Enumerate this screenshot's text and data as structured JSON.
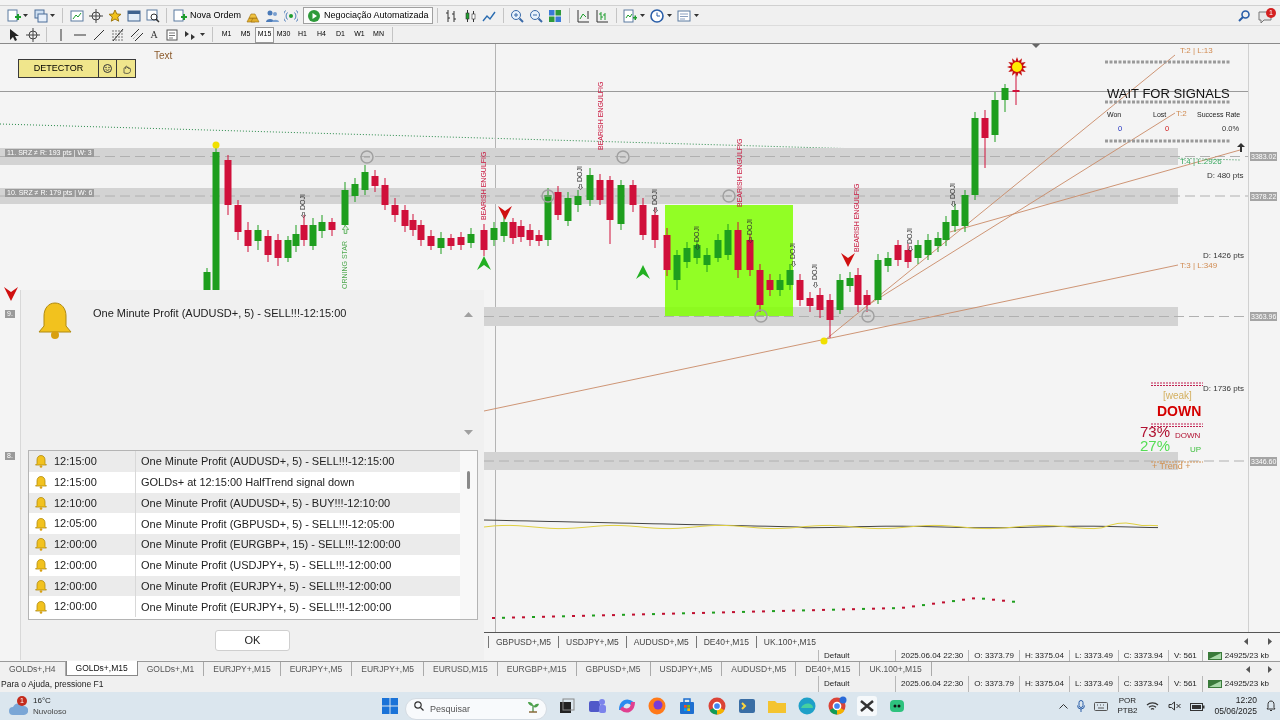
{
  "toolbar": {
    "order_button": "Nova Ordem",
    "algo_button": {
      "label": "Negociação Automatizada",
      "on": true
    },
    "alerts_badge": "1",
    "text_tool": "A",
    "timeframes": [
      {
        "label": "M1",
        "selected": false
      },
      {
        "label": "M5",
        "selected": false
      },
      {
        "label": "M15",
        "selected": true
      },
      {
        "label": "M30",
        "selected": false
      },
      {
        "label": "H1",
        "selected": false
      },
      {
        "label": "H4",
        "selected": false
      },
      {
        "label": "D1",
        "selected": false
      },
      {
        "label": "W1",
        "selected": false
      },
      {
        "label": "MN",
        "selected": false
      }
    ]
  },
  "chart": {
    "detector_panel": {
      "label": "DETECTOR"
    },
    "text_object": "Text",
    "zones": [
      {
        "label": "11. SRZ ≠ R: 193 pts | W: 3",
        "price": "3383.02"
      },
      {
        "label": "10. SRZ ≠ R: 179 pts | W: 6",
        "price": "3378.22"
      },
      {
        "label": "9.",
        "price": "3363.96"
      },
      {
        "label": "8.",
        "price": "3346.60"
      }
    ],
    "patterns": [
      {
        "kind": "doji",
        "text": "DOJI"
      },
      {
        "kind": "bullish",
        "text": "ORNING STAR"
      },
      {
        "kind": "bearish",
        "text": "BEARISH ENGULFIG"
      },
      {
        "kind": "doji",
        "text": "DOJI"
      },
      {
        "kind": "bearish",
        "text": "BEARISH ENGULFIG"
      },
      {
        "kind": "doji",
        "text": "DOJI"
      },
      {
        "kind": "doji",
        "text": "DOJI"
      },
      {
        "kind": "bearish",
        "text": "BEARISH ENGULFIG"
      },
      {
        "kind": "doji",
        "text": "DOJI"
      },
      {
        "kind": "doji",
        "text": "DOJI"
      },
      {
        "kind": "doji",
        "text": "DOJI"
      },
      {
        "kind": "bearish",
        "text": "BEARISH ENGULFIG"
      },
      {
        "kind": "doji",
        "text": "DOJI"
      },
      {
        "kind": "doji",
        "text": "DOJI"
      }
    ],
    "line_labels": [
      {
        "kind": "trendline",
        "text": "T:2 | L:13"
      },
      {
        "kind": "trendline",
        "text": "T:2"
      },
      {
        "kind": "dotline",
        "text": "T:4 | L:2926"
      },
      {
        "kind": "distance",
        "text": "D: 480 pts"
      },
      {
        "kind": "distance",
        "text": "D: 1426 pts"
      },
      {
        "kind": "trendline",
        "text": "T:3 | L:349"
      },
      {
        "kind": "distance",
        "text": "D: 1736 pts"
      }
    ],
    "signal_panel": {
      "title": "WAIT FOR SIGNALS",
      "stats": [
        {
          "kind": "won",
          "label": "Won",
          "value": "0"
        },
        {
          "kind": "lost",
          "label": "Lost",
          "value": "0"
        },
        {
          "kind": "rate",
          "label": "Success Rate",
          "value": "0.0%"
        }
      ]
    },
    "trend_meter": {
      "strength": "[weak]",
      "direction": "DOWN",
      "down_share": "73%",
      "down_label": "DOWN",
      "up_share": "27%",
      "up_label": "UP",
      "footer": "+ Trend +"
    }
  },
  "alert_dialog": {
    "message": "One Minute Profit (AUDUSD+, 5) - SELL!!!-12:15:00",
    "rows": [
      {
        "time": "12:15:00",
        "text": "One Minute Profit (AUDUSD+, 5) - SELL!!!-12:15:00"
      },
      {
        "time": "12:15:00",
        "text": "GOLDs+ at 12:15:00 HalfTrend signal down"
      },
      {
        "time": "12:10:00",
        "text": "One Minute Profit (AUDUSD+, 5) - BUY!!!-12:10:00"
      },
      {
        "time": "12:05:00",
        "text": "One Minute Profit (GBPUSD+, 5) - SELL!!!-12:05:00"
      },
      {
        "time": "12:00:00",
        "text": "One Minute Profit (EURGBP+, 15) - SELL!!!-12:00:00"
      },
      {
        "time": "12:00:00",
        "text": "One Minute Profit (USDJPY+, 5) - SELL!!!-12:00:00"
      },
      {
        "time": "12:00:00",
        "text": "One Minute Profit (EURJPY+, 5) - SELL!!!-12:00:00"
      },
      {
        "time": "12:00:00",
        "text": "One Minute Profit (EURJPY+, 5) - SELL!!!-12:00:00"
      }
    ],
    "ok_button": "OK"
  },
  "second_tab_row": [
    "GBPUSD+,M5",
    "USDJPY+,M5",
    "AUDUSD+,M5",
    "DE40+,M15",
    "UK.100+,M15"
  ],
  "second_status_row": [
    "Default",
    "2025.06.04 22:30",
    "O: 3373.79",
    "H: 3375.04",
    "L: 3373.49",
    "C: 3373.94",
    "V: 561",
    "24925/23 kb"
  ],
  "chart_tabs": [
    {
      "label": "GOLDs+,H4",
      "selected": false
    },
    {
      "label": "GOLDs+,M15",
      "selected": true
    },
    {
      "label": "GOLDs+,M1",
      "selected": false
    },
    {
      "label": "EURJPY+,M15",
      "selected": false
    },
    {
      "label": "EURJPY+,M5",
      "selected": false
    },
    {
      "label": "EURJPY+,M5",
      "selected": false
    },
    {
      "label": "EURUSD,M15",
      "selected": false
    },
    {
      "label": "EURGBP+,M15",
      "selected": false
    },
    {
      "label": "GBPUSD+,M5",
      "selected": false
    },
    {
      "label": "USDJPY+,M5",
      "selected": false
    },
    {
      "label": "AUDUSD+,M5",
      "selected": false
    },
    {
      "label": "DE40+,M15",
      "selected": false
    },
    {
      "label": "UK.100+,M15",
      "selected": false
    }
  ],
  "status_bar": {
    "help": "Para o Ajuda, pressione F1",
    "fields": [
      "Default",
      "2025.06.04 22:30",
      "O: 3373.79",
      "H: 3375.04",
      "L: 3373.49",
      "C: 3373.94",
      "V: 561",
      "24925/23 kb"
    ]
  },
  "taskbar": {
    "weather": {
      "badge": "1",
      "temperature": "16°C",
      "condition": "Nuvoloso"
    },
    "search": {
      "placeholder": "Pesquisar"
    },
    "language": "POR",
    "layout": "PTB2",
    "time": "12:20",
    "date": "05/06/2025"
  }
}
